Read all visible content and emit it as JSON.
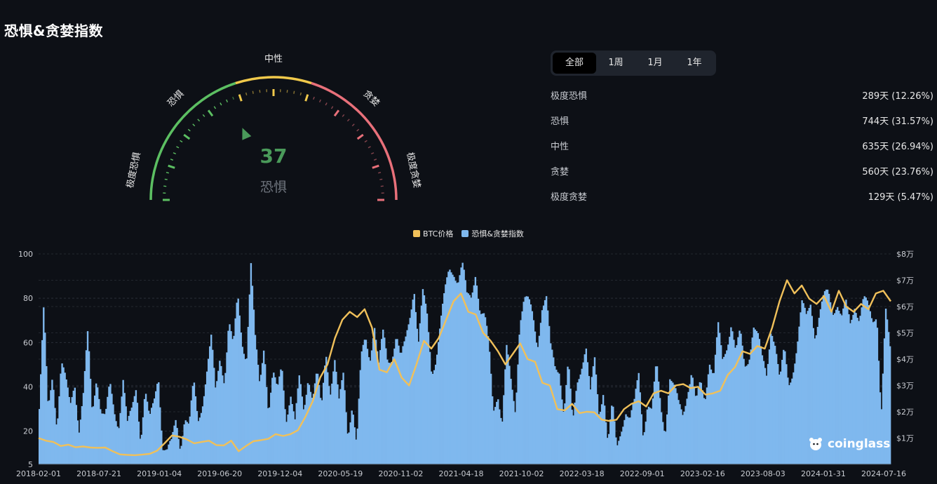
{
  "page": {
    "title": "恐惧&贪婪指数"
  },
  "gauge": {
    "value": "37",
    "sentiment": "恐惧",
    "labels": {
      "extreme_fear": "极度恐惧",
      "fear": "恐惧",
      "neutral": "中性",
      "greed": "贪婪",
      "extreme_greed": "极度贪婪"
    },
    "colors": {
      "green": "#5cbf62",
      "yellow": "#f0c94b",
      "red": "#e8707a",
      "value": "#4a9a5a",
      "sentiment": "#6f757e"
    }
  },
  "tabs": [
    {
      "label": "全部",
      "active": true
    },
    {
      "label": "1周",
      "active": false
    },
    {
      "label": "1月",
      "active": false
    },
    {
      "label": "1年",
      "active": false
    }
  ],
  "stats": [
    {
      "label": "极度恐惧",
      "value": "289天 (12.26%)"
    },
    {
      "label": "恐惧",
      "value": "744天 (31.57%)"
    },
    {
      "label": "中性",
      "value": "635天 (26.94%)"
    },
    {
      "label": "贪婪",
      "value": "560天 (23.76%)"
    },
    {
      "label": "极度贪婪",
      "value": "129天 (5.47%)"
    }
  ],
  "legend": [
    {
      "label": "BTC价格",
      "color": "#f0c05a"
    },
    {
      "label": "恐惧&贪婪指数",
      "color": "#7fb8ee"
    }
  ],
  "logo": {
    "text": "coinglass"
  },
  "chart_data": {
    "type": "area",
    "x_ticks": [
      "2018-02-01",
      "2018-07-21",
      "2019-01-04",
      "2019-06-20",
      "2019-12-04",
      "2020-05-19",
      "2020-11-02",
      "2021-04-18",
      "2021-10-02",
      "2022-03-18",
      "2022-09-01",
      "2023-02-16",
      "2023-08-03",
      "2024-01-31",
      "2024-07-16"
    ],
    "y_left_ticks": [
      "5",
      "20",
      "40",
      "60",
      "80",
      "100"
    ],
    "y_left_range": [
      5,
      100
    ],
    "y_right_ticks": [
      "$1万",
      "$2万",
      "$3万",
      "$4万",
      "$5万",
      "$6万",
      "$7万",
      "$8万"
    ],
    "y_right_range": [
      0,
      80000
    ],
    "grid": true,
    "series": [
      {
        "name": "恐惧&贪婪指数",
        "color": "#7fb8ee",
        "values": [
          30,
          73,
          28,
          48,
          24,
          50,
          40,
          31,
          45,
          22,
          35,
          62,
          28,
          48,
          30,
          24,
          39,
          30,
          25,
          44,
          20,
          28,
          42,
          18,
          38,
          22,
          32,
          48,
          15,
          10,
          12,
          25,
          15,
          28,
          20,
          40,
          25,
          35,
          48,
          60,
          35,
          55,
          45,
          70,
          55,
          80,
          62,
          55,
          95,
          58,
          40,
          62,
          30,
          45,
          35,
          50,
          28,
          38,
          22,
          42,
          30,
          48,
          35,
          44,
          28,
          58,
          40,
          52,
          30,
          45,
          20,
          35,
          12,
          50,
          62,
          55,
          70,
          48,
          62,
          52,
          56,
          65,
          50,
          58,
          72,
          88,
          60,
          80,
          70,
          48,
          55,
          68,
          80,
          92,
          94,
          90,
          95,
          78,
          80,
          95,
          75,
          70,
          56,
          30,
          40,
          24,
          55,
          40,
          30,
          72,
          80,
          76,
          70,
          60,
          78,
          80,
          55,
          48,
          50,
          30,
          50,
          20,
          42,
          52,
          60,
          35,
          50,
          28,
          42,
          15,
          30,
          10,
          22,
          32,
          25,
          30,
          45,
          20,
          35,
          28,
          48,
          30,
          22,
          46,
          38,
          30,
          28,
          40,
          48,
          30,
          40,
          35,
          55,
          45,
          65,
          50,
          60,
          72,
          55,
          62,
          48,
          55,
          70,
          62,
          50,
          45,
          70,
          60,
          40,
          55,
          42,
          50,
          60,
          75,
          70,
          80,
          65,
          72,
          78,
          82,
          76,
          80,
          70,
          75,
          68,
          80,
          72,
          78,
          74,
          70,
          76,
          28,
          72,
          55
        ]
      },
      {
        "name": "BTC价格",
        "color": "#f0c05a",
        "values": [
          10000,
          9000,
          8500,
          7000,
          7500,
          6500,
          6800,
          6400,
          6300,
          6400,
          5000,
          3800,
          3600,
          3500,
          3700,
          4000,
          5200,
          8000,
          11000,
          10500,
          9500,
          8000,
          8500,
          9000,
          7300,
          7200,
          9000,
          5000,
          7000,
          8800,
          9200,
          9700,
          11500,
          10800,
          11500,
          13000,
          18000,
          24000,
          33000,
          38000,
          48000,
          55000,
          58000,
          56000,
          59000,
          52000,
          36000,
          35000,
          40000,
          33000,
          30000,
          38000,
          47000,
          44000,
          48000,
          55000,
          62000,
          65000,
          58000,
          57000,
          50000,
          47000,
          43000,
          38000,
          42000,
          46000,
          40000,
          39000,
          31000,
          30000,
          21000,
          20500,
          23000,
          19500,
          20000,
          19800,
          17000,
          16500,
          17000,
          21000,
          23000,
          24000,
          22000,
          27000,
          28000,
          27000,
          30000,
          30500,
          29000,
          29500,
          26500,
          27000,
          28000,
          34000,
          37000,
          43000,
          42000,
          45000,
          44000,
          52000,
          62000,
          70000,
          65000,
          68000,
          63000,
          61000,
          64000,
          58000,
          66000,
          60000,
          58000,
          61000,
          59000,
          65000,
          66000,
          62000
        ]
      }
    ]
  }
}
